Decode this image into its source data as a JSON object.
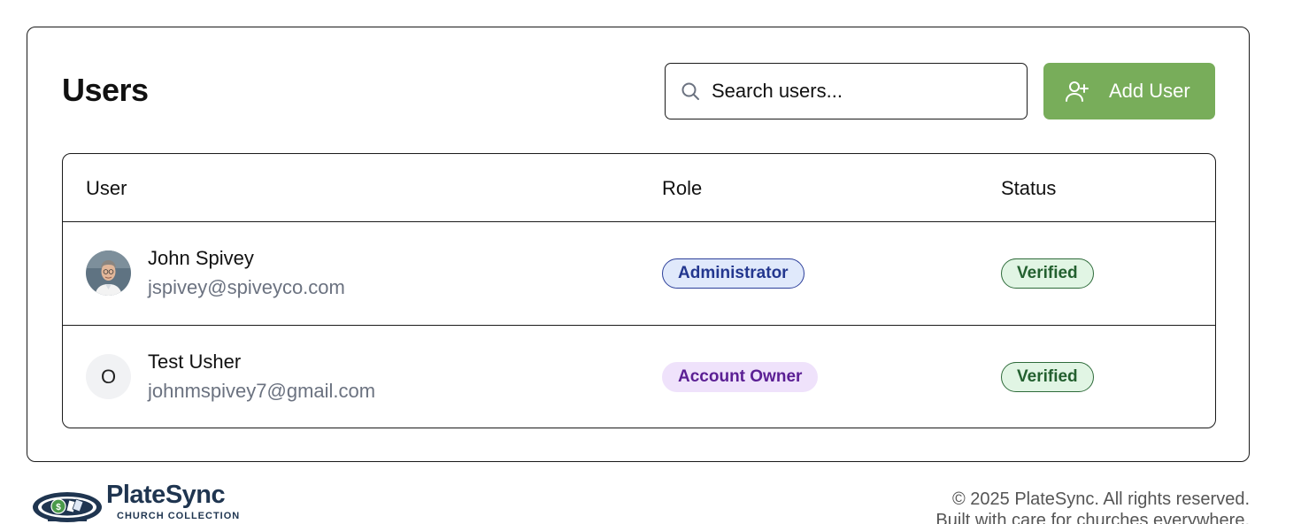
{
  "header": {
    "title": "Users",
    "search_placeholder": "Search users...",
    "add_button_label": "Add User"
  },
  "table": {
    "columns": [
      "User",
      "Role",
      "Status"
    ],
    "rows": [
      {
        "name": "John Spivey",
        "email": "jspivey@spiveyco.com",
        "role": "Administrator",
        "status": "Verified",
        "avatar": "photo"
      },
      {
        "name": "Test Usher",
        "email": "johnmspivey7@gmail.com",
        "role": "Account Owner",
        "status": "Verified",
        "avatar_initial": "O"
      }
    ]
  },
  "footer": {
    "brand": "PlateSync",
    "brand_sub": "CHURCH COLLECTION",
    "copyright": "© 2025 PlateSync. All rights reserved.",
    "tagline": "Built with care for churches everywhere."
  },
  "colors": {
    "accent_green": "#78ad5a",
    "admin_badge_bg": "#e0e9fb",
    "owner_badge_bg": "#efe2fb",
    "verified_badge_bg": "#e1f5e4",
    "brand_navy": "#1f3550"
  },
  "icons": {
    "search": "search-icon",
    "add_user": "user-plus-icon"
  }
}
